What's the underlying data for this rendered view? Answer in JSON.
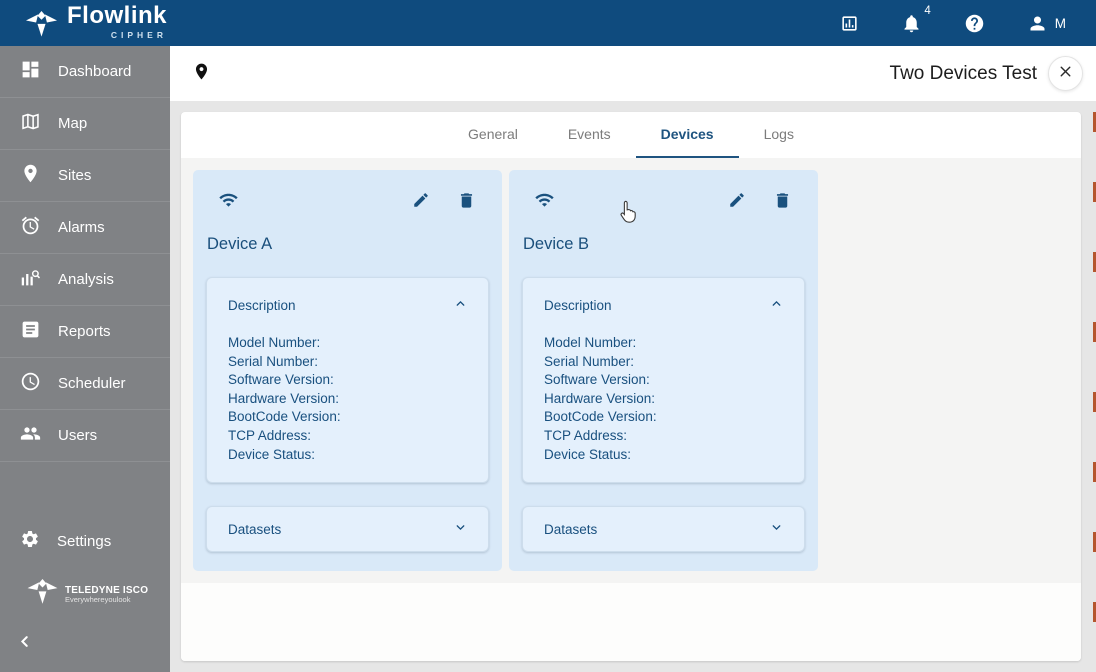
{
  "colors": {
    "topbar": "#0f4b7e",
    "sidebar": "#808285",
    "accent_blue": "#1a517e",
    "card_bg": "#d9e9f8",
    "sub_panel_bg": "#e4f0fc",
    "page_bg": "#e6e6e6",
    "active_tab": "#1f5480",
    "artifact_red": "#b5562e"
  },
  "topbar": {
    "brand": "Flowlink",
    "brand_sub": "CIPHER",
    "notification_count": "4",
    "user_initial": "M",
    "icons": [
      "bar-chart",
      "notifications-bell",
      "help",
      "user"
    ]
  },
  "sidebar": {
    "items": [
      {
        "label": "Dashboard",
        "icon": "dashboard-grid"
      },
      {
        "label": "Map",
        "icon": "folded-map"
      },
      {
        "label": "Sites",
        "icon": "location-pin"
      },
      {
        "label": "Alarms",
        "icon": "alarm-clock"
      },
      {
        "label": "Analysis",
        "icon": "chart-magnifier"
      },
      {
        "label": "Reports",
        "icon": "document"
      },
      {
        "label": "Scheduler",
        "icon": "clock"
      },
      {
        "label": "Users",
        "icon": "people"
      }
    ],
    "settings": {
      "label": "Settings",
      "icon": "gear"
    },
    "footer_brand": {
      "line1": "TELEDYNE ISCO",
      "line2": "Everywhereyoulook"
    },
    "collapse_icon": "chevron-left"
  },
  "header": {
    "site_icon": "location-pin",
    "title": "Two Devices Test",
    "close_icon": "close-x"
  },
  "tabs": [
    {
      "label": "General",
      "active": false
    },
    {
      "label": "Events",
      "active": false
    },
    {
      "label": "Devices",
      "active": true
    },
    {
      "label": "Logs",
      "active": false
    }
  ],
  "devices": [
    {
      "name": "Device A"
    },
    {
      "name": "Device B"
    }
  ],
  "device_panel": {
    "description_title": "Description",
    "fields": [
      "Model Number:",
      "Serial Number:",
      "Software Version:",
      "Hardware Version:",
      "BootCode Version:",
      "TCP Address:",
      "Device Status:"
    ],
    "datasets_title": "Datasets",
    "card_icons": [
      "wifi",
      "edit-pencil",
      "trash"
    ]
  }
}
